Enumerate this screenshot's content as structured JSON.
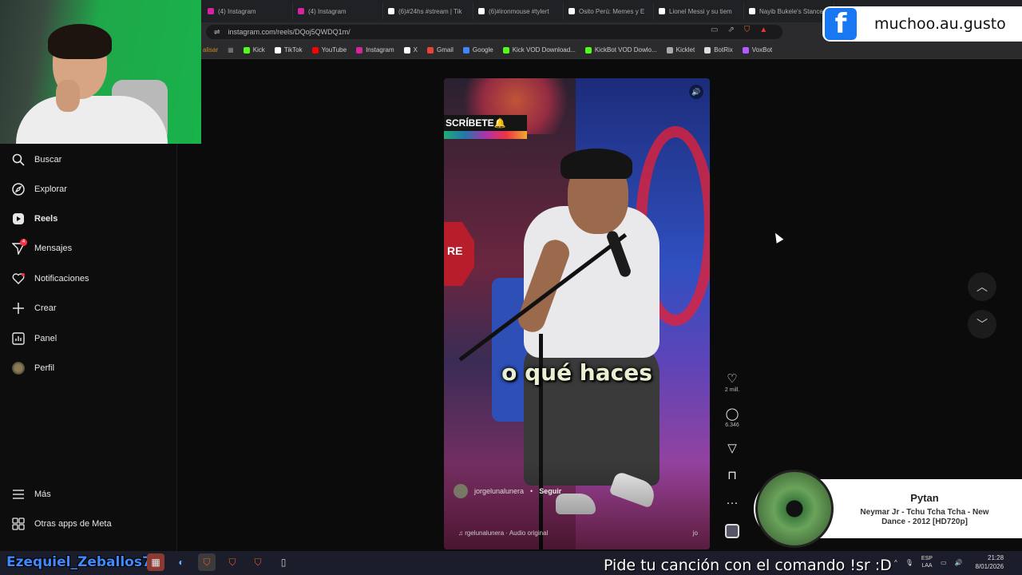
{
  "browser": {
    "tabs": [
      {
        "label": "(4) Instagram",
        "color": "#d6249f"
      },
      {
        "label": "(4) Instagram",
        "color": "#d6249f"
      },
      {
        "label": "(6)#24hs #stream | Tik",
        "color": "#ffffff"
      },
      {
        "label": "(6)#ironmouse #tylert",
        "color": "#ffffff"
      },
      {
        "label": "Osito Perú: Memes y E",
        "color": "#ffffff"
      },
      {
        "label": "Lionel Messi y su tiem",
        "color": "#ffffff"
      },
      {
        "label": "Nayib Bukele's Stance",
        "color": "#ffffff"
      }
    ],
    "url": "instagram.com/reels/DQoj5QWDQ1m/",
    "bookmarks": [
      {
        "label": "Kick",
        "color": "#53fc18"
      },
      {
        "label": "TikTok",
        "color": "#ffffff"
      },
      {
        "label": "YouTube",
        "color": "#ff0000"
      },
      {
        "label": "Instagram",
        "color": "#d6249f"
      },
      {
        "label": "X",
        "color": "#ffffff"
      },
      {
        "label": "Gmail",
        "color": "#ea4335"
      },
      {
        "label": "Google",
        "color": "#4285f4"
      },
      {
        "label": "Kick VOD Download...",
        "color": "#53fc18"
      },
      {
        "label": "KickBot VOD Dowlo...",
        "color": "#53fc18"
      },
      {
        "label": "Kicklet",
        "color": "#aaaaaa"
      },
      {
        "label": "BotRix",
        "color": "#dddddd"
      },
      {
        "label": "VoxBot",
        "color": "#b25cff"
      }
    ],
    "bookmarks_partial": "alisar"
  },
  "overlay": {
    "facebook_letter": "f",
    "facebook_handle": "muchoo.au.gusto"
  },
  "sidebar": {
    "items": [
      {
        "label": "Buscar",
        "icon": "search-icon"
      },
      {
        "label": "Explorar",
        "icon": "compass-icon"
      },
      {
        "label": "Reels",
        "icon": "reels-icon"
      },
      {
        "label": "Mensajes",
        "icon": "messages-icon",
        "badge": "4"
      },
      {
        "label": "Notificaciones",
        "icon": "heart-icon"
      },
      {
        "label": "Crear",
        "icon": "plus-icon"
      },
      {
        "label": "Panel",
        "icon": "dashboard-icon"
      },
      {
        "label": "Perfil",
        "icon": "avatar-icon"
      }
    ],
    "more_label": "Más",
    "meta_label": "Otras apps de Meta"
  },
  "reel": {
    "subscribe_text": "SCRÍBETE🔔",
    "stop_text": "RE",
    "caption": "o qué haces",
    "author": "jorgelunalunera",
    "follow_label": "Seguir",
    "audio": "rgelunalunera · Audio original",
    "audio_tail": "jo"
  },
  "actions": {
    "likes": "2 mill.",
    "comments": "6.346"
  },
  "now_playing": {
    "requester": "Pytan",
    "song": "Neymar Jr - Tchu Tcha Tcha - New Dance - 2012 [HD720p]"
  },
  "stream": {
    "username": "Ezequiel_Zeballos7:",
    "song_request": "Pide tu canción con el comando !sr :D"
  },
  "taskbar": {
    "lang_top": "ESP",
    "lang_bottom": "LAA",
    "time": "21:28",
    "date": "8/01/2026"
  }
}
